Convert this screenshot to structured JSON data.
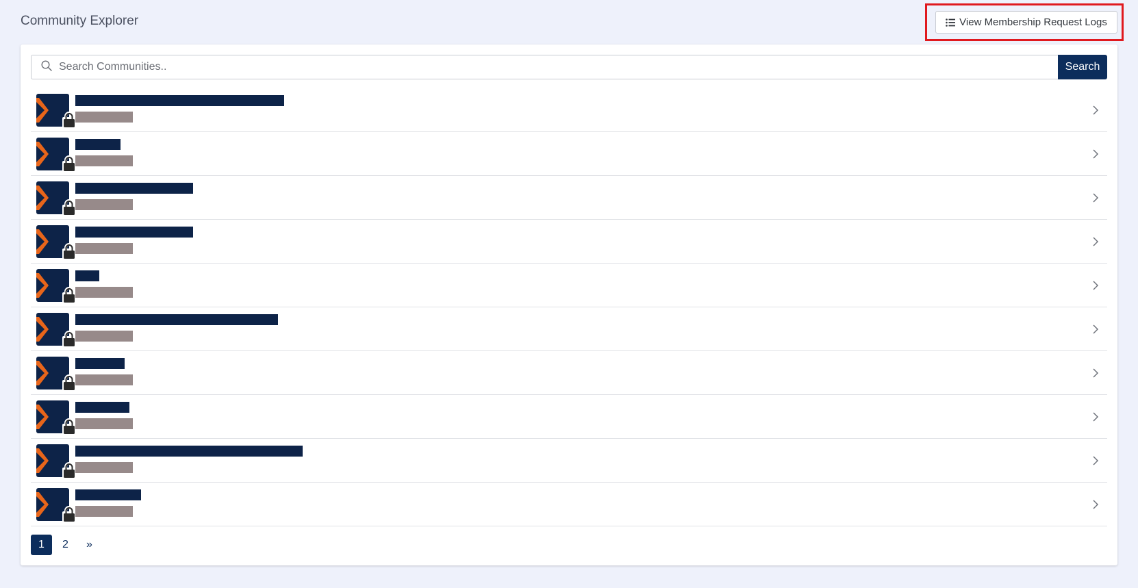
{
  "header": {
    "title": "Community Explorer",
    "logs_button_label": "View Membership Request Logs",
    "logs_button_icon": "list-icon"
  },
  "search": {
    "placeholder": "Search Communities..",
    "value": "",
    "button_label": "Search"
  },
  "communities": {
    "count_visible": 10,
    "items_note": "names redacted",
    "name_bar_widths": [
      305,
      66,
      172,
      172,
      35,
      296,
      72,
      79,
      332,
      96
    ]
  },
  "pagination": {
    "pages": [
      "1",
      "2"
    ],
    "current": "1",
    "next_label": "»"
  },
  "colors": {
    "brand_navy": "#0c2d5c",
    "avatar_bg": "#0d2348",
    "avatar_accent": "#e8651a",
    "highlight": "#e0191e",
    "redaction_name": "#0d2348",
    "redaction_sub": "#978a8a"
  }
}
